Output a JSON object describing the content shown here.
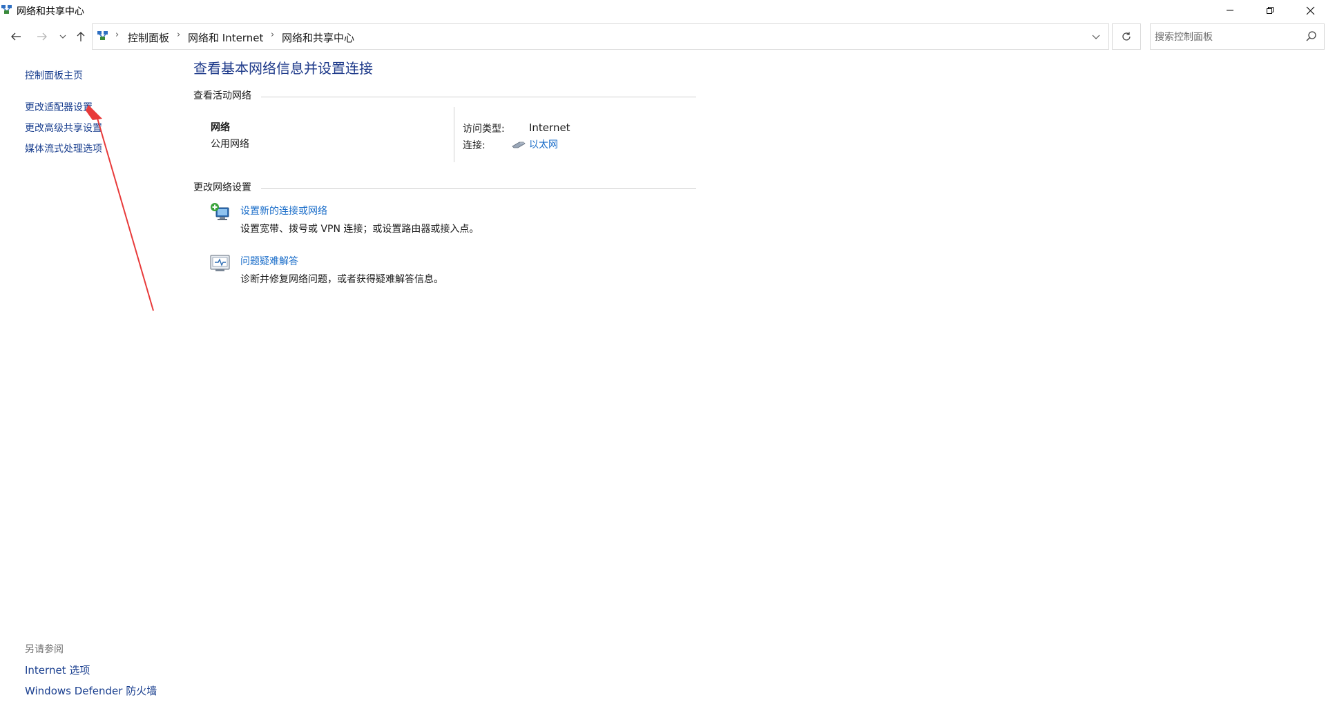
{
  "window": {
    "title": "网络和共享中心"
  },
  "address": {
    "breadcrumbs": [
      "控制面板",
      "网络和 Internet",
      "网络和共享中心"
    ],
    "search_placeholder": "搜索控制面板"
  },
  "sidebar": {
    "home": "控制面板主页",
    "items": [
      "更改适配器设置",
      "更改高级共享设置",
      "媒体流式处理选项"
    ],
    "see_also_label": "另请参阅",
    "see_also": [
      "Internet 选项",
      "Windows Defender 防火墙"
    ]
  },
  "main": {
    "title": "查看基本网络信息并设置连接",
    "active_section": "查看活动网络",
    "network": {
      "name": "网络",
      "type": "公用网络",
      "access_label": "访问类型:",
      "access_value": "Internet",
      "connection_label": "连接:",
      "connection_value": "以太网"
    },
    "change_section": "更改网络设置",
    "tasks": [
      {
        "link": "设置新的连接或网络",
        "desc": "设置宽带、拨号或 VPN 连接；或设置路由器或接入点。"
      },
      {
        "link": "问题疑难解答",
        "desc": "诊断并修复网络问题，或者获得疑难解答信息。"
      }
    ]
  },
  "icons": {
    "app": "network-center-icon",
    "back": "arrow-left-icon",
    "forward": "arrow-right-icon",
    "recent": "chevron-down-icon",
    "up": "arrow-up-icon",
    "refresh": "refresh-icon",
    "search": "search-icon",
    "ethernet": "ethernet-cable-icon",
    "new_connection": "new-connection-icon",
    "troubleshoot": "troubleshoot-icon"
  },
  "colors": {
    "link": "#1a6dc9",
    "sidebar_link": "#1a3f8f",
    "title": "#1e3a8a",
    "annotation_arrow": "#e83a3a"
  }
}
